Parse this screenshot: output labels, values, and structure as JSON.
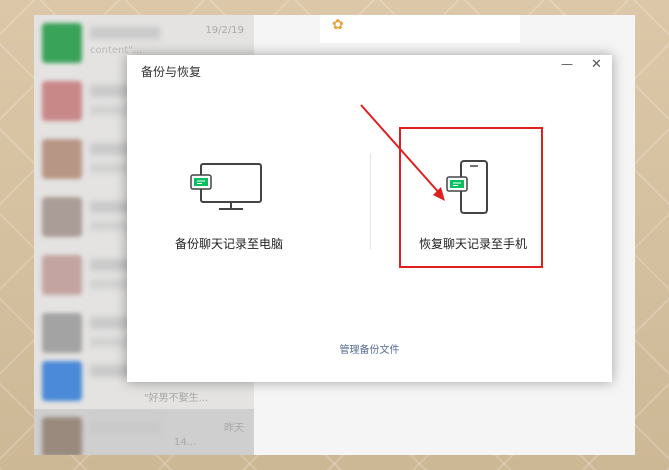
{
  "chat_list": {
    "items": [
      {
        "time": "19/2/19",
        "snippet": "content\"..."
      },
      {
        "time": "",
        "snippet": ""
      },
      {
        "time": "",
        "snippet": ""
      },
      {
        "time": "",
        "snippet": ""
      },
      {
        "time": "",
        "snippet": ""
      },
      {
        "time": "",
        "snippet": ""
      },
      {
        "time": "",
        "snippet": "\"好男不娶生..."
      },
      {
        "time": "昨天",
        "snippet": "14..."
      }
    ]
  },
  "dialog": {
    "title": "备份与恢复",
    "minimize_icon": "—",
    "close_icon": "✕",
    "backup_to_pc_label": "备份聊天记录至电脑",
    "restore_to_phone_label": "恢复聊天记录至手机",
    "manage_link": "管理备份文件"
  },
  "colors": {
    "highlight": "#e02020",
    "link": "#576b95",
    "accent_green": "#07c160"
  }
}
